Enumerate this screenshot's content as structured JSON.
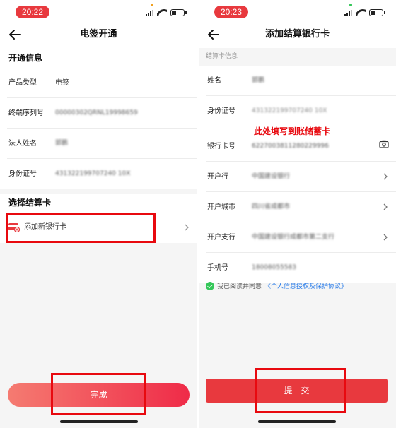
{
  "left": {
    "status_time": "20:22",
    "title": "电签开通",
    "section_info": "开通信息",
    "info_rows": [
      {
        "label": "产品类型",
        "value": "电签"
      },
      {
        "label": "终端序列号",
        "value": "00000302QRNL19998659"
      },
      {
        "label": "法人姓名",
        "value": "郭鹏"
      },
      {
        "label": "身份证号",
        "value": "431322199707240 10X"
      }
    ],
    "section_card": "选择结算卡",
    "add_card_label": "添加新银行卡",
    "done_label": "完成"
  },
  "right": {
    "status_time": "20:23",
    "title": "添加结算银行卡",
    "hint": "结算卡信息",
    "rows": [
      {
        "label": "姓名",
        "value": "郭鹏"
      },
      {
        "label": "身份证号",
        "value": "431322199707240 10X"
      },
      {
        "label": "银行卡号",
        "value": "6227003811280229996"
      },
      {
        "label": "开户行",
        "value": "中国建设银行"
      },
      {
        "label": "开户城市",
        "value": "四川省成都市"
      },
      {
        "label": "开户支行",
        "value": "中国建设银行成都市第二支行"
      },
      {
        "label": "手机号",
        "value": "18008055583"
      }
    ],
    "annotation": "此处填写到账储蓄卡",
    "agree_text": "我已阅读并同意",
    "agree_link": "《个人信息授权及保护协议》",
    "submit_label": "提交"
  },
  "colors": {
    "accent": "#e8393e",
    "annotation": "#e8090f",
    "link": "#2b7de9",
    "check": "#34c759"
  },
  "icons": [
    "back-arrow-icon",
    "chevron-right-icon",
    "bank-card-icon",
    "camera-icon",
    "check-circle-icon",
    "signal-icon",
    "wifi-icon",
    "battery-icon"
  ]
}
